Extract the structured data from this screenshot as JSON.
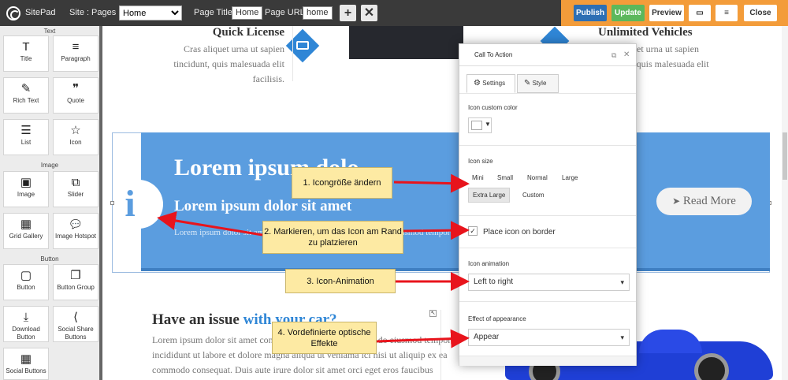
{
  "topbar": {
    "brand": "SitePad",
    "site_label": "Site :",
    "pages_label": "Pages :",
    "pages_selected": "Home",
    "page_title_label": "Page Title:",
    "page_title_value": "Home",
    "page_url_label": "Page URL:",
    "page_url_value": "home",
    "add_icon": "plus-icon",
    "close_icon": "x-icon",
    "publish": "Publish",
    "update": "Update",
    "preview": "Preview",
    "close": "Close",
    "colors": {
      "bar": "#3a3a3a",
      "right": "#f39c3a",
      "publish": "#2d6fb4",
      "update": "#5cb85c"
    }
  },
  "sidebar": {
    "sections": [
      "Text",
      "Image",
      "Button"
    ],
    "widgets": [
      {
        "label": "Title",
        "icon": "T"
      },
      {
        "label": "Paragraph",
        "icon": "≡"
      },
      {
        "label": "Rich Text",
        "icon": "✎"
      },
      {
        "label": "Quote",
        "icon": "❞"
      },
      {
        "label": "List",
        "icon": "☰"
      },
      {
        "label": "Icon",
        "icon": "☆"
      },
      {
        "label": "Image",
        "icon": "▣"
      },
      {
        "label": "Slider",
        "icon": "⧉"
      },
      {
        "label": "Grid Gallery",
        "icon": "▦"
      },
      {
        "label": "Image Hotspot",
        "icon": "💬"
      },
      {
        "label": "Button",
        "icon": "▢"
      },
      {
        "label": "Button Group",
        "icon": "❐"
      },
      {
        "label": "Download Button",
        "icon": "⤓"
      },
      {
        "label": "Social Share Buttons",
        "icon": "⟨"
      },
      {
        "label": "Social Buttons",
        "icon": "▦"
      }
    ]
  },
  "page": {
    "quick_license_title": "Quick License",
    "quick_license_text": "Cras aliquet urna ut sapien tincidunt, quis malesuada elit facilisis.",
    "unlimited_title": "Unlimited Vehicles",
    "unlimited_text": "Cras aliquet urna ut sapien tincidunt, quis malesuada elit facilisis.",
    "cta_heading": "Lorem ipsum dolo",
    "cta_subheading": "Lorem ipsum dolor sit amet",
    "cta_text": "Lorem ipsum dolor sit amet, consectetur adipiscing elit, sed do eiusmod tempor incididunt ut labore et dolore magna aliqua.",
    "read_more": "Read More",
    "issue_heading_a": "Have an issue",
    "issue_heading_b": "with your car?",
    "issue_text": "Lorem ipsum dolor sit amet consectetur adipiscing elit, sed do eiusmod tempor incididunt ut labore et dolore magna aliqua ut veniama ici nisi ut aliquip ex ea commodo consequat. Duis aute irure dolor sit amet orci eget eros faucibus tincidunt. Sed fringilla mauris sit amet nibh. Donec sodales sagittis magna.",
    "cta_color": "#5b9ddf"
  },
  "dialog": {
    "title": "Call To Action",
    "tab_settings": "Settings",
    "tab_style": "Style",
    "icon_color_label": "Icon custom color",
    "icon_size_label": "Icon size",
    "sizes": [
      "Mini",
      "Small",
      "Normal",
      "Large",
      "Extra Large",
      "Custom"
    ],
    "size_selected": "Extra Large",
    "place_on_border": "Place icon on border",
    "place_on_border_checked": true,
    "animation_label": "Icon animation",
    "animation_value": "Left to right",
    "effect_label": "Effect of appearance",
    "effect_value": "Appear"
  },
  "callouts": [
    "1. Icongröße ändern",
    "2. Markieren, um das Icon am Rand zu platzieren",
    "3. Icon-Animation",
    "4. Vordefinierte optische Effekte"
  ]
}
